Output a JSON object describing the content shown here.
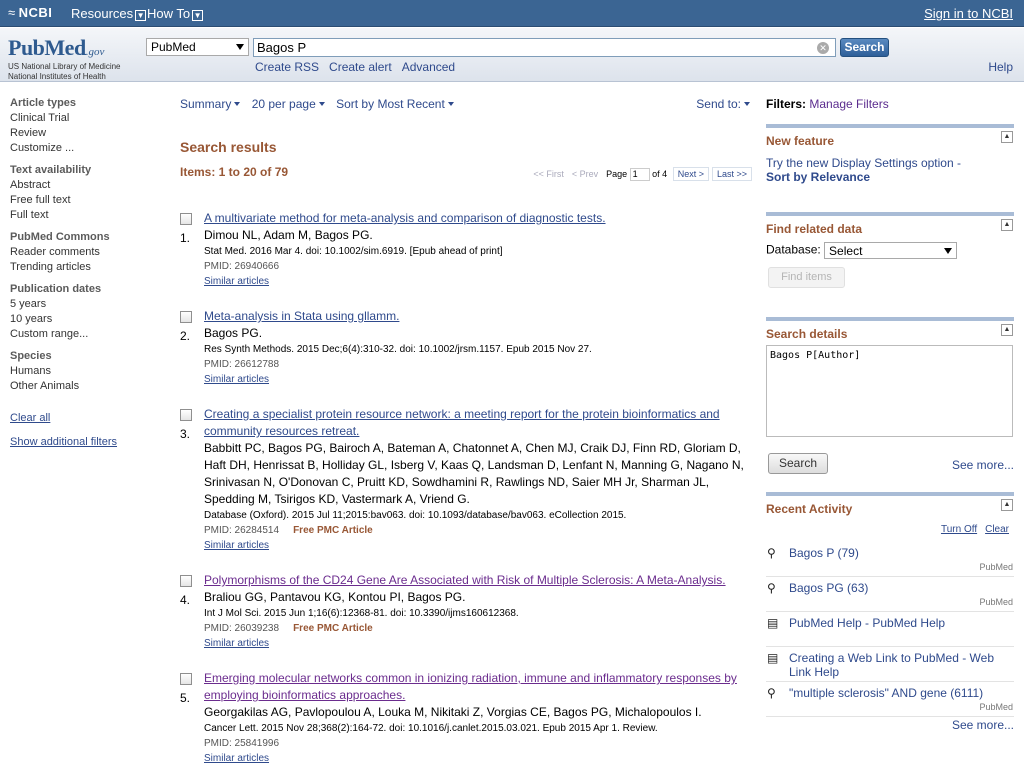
{
  "topbar": {
    "ncbi": "NCBI",
    "resources": "Resources",
    "howto": "How To",
    "signin": "Sign in to NCBI"
  },
  "brand": {
    "pubmed": "PubMed",
    "gov": ".gov",
    "line1": "US National Library of Medicine",
    "line2": "National Institutes of Health"
  },
  "search": {
    "database": "PubMed",
    "query": "Bagos P",
    "button": "Search",
    "links": [
      "Create RSS",
      "Create alert",
      "Advanced"
    ],
    "help": "Help"
  },
  "left_filters": {
    "groups": [
      {
        "header": "Article types",
        "items": [
          "Clinical Trial",
          "Review",
          "Customize ..."
        ]
      },
      {
        "header": "Text availability",
        "items": [
          "Abstract",
          "Free full text",
          "Full text"
        ]
      },
      {
        "header": "PubMed Commons",
        "items": [
          "Reader comments",
          "Trending articles"
        ]
      },
      {
        "header": "Publication dates",
        "items": [
          "5 years",
          "10 years",
          "Custom range..."
        ]
      },
      {
        "header": "Species",
        "items": [
          "Humans",
          "Other Animals"
        ]
      }
    ],
    "clear_all": "Clear all",
    "show_additional": "Show additional filters"
  },
  "toolbar": {
    "summary": "Summary",
    "per_page": "20 per page",
    "sort": "Sort by Most Recent",
    "send_to": "Send to:"
  },
  "results": {
    "title": "Search results",
    "items": "Items: 1 to 20 of 79",
    "pager": {
      "first": "<< First",
      "prev": "< Prev",
      "page_label": "Page",
      "page": "1",
      "of": "of 4",
      "next": "Next >",
      "last": "Last >>"
    },
    "list": [
      {
        "num": "1.",
        "title": "A multivariate method for meta-analysis and comparison of diagnostic tests.",
        "authors": "Dimou NL, Adam M, Bagos PG.",
        "source": "Stat Med. 2016 Mar 4. doi: 10.1002/sim.6919. [Epub ahead of print]",
        "pmid": "PMID: 26940666",
        "pmc": "",
        "similar": "Similar articles"
      },
      {
        "num": "2.",
        "title": "Meta-analysis in Stata using gllamm.",
        "authors": "Bagos PG.",
        "source": "Res Synth Methods. 2015 Dec;6(4):310-32. doi: 10.1002/jrsm.1157. Epub 2015 Nov 27.",
        "pmid": "PMID: 26612788",
        "pmc": "",
        "similar": "Similar articles"
      },
      {
        "num": "3.",
        "title": "Creating a specialist protein resource network: a meeting report for the protein bioinformatics and community resources retreat.",
        "authors": "Babbitt PC, Bagos PG, Bairoch A, Bateman A, Chatonnet A, Chen MJ, Craik DJ, Finn RD, Gloriam D, Haft DH, Henrissat B, Holliday GL, Isberg V, Kaas Q, Landsman D, Lenfant N, Manning G, Nagano N, Srinivasan N, O'Donovan C, Pruitt KD, Sowdhamini R, Rawlings ND, Saier MH Jr, Sharman JL, Spedding M, Tsirigos KD, Vastermark A, Vriend G.",
        "source": "Database (Oxford). 2015 Jul 11;2015:bav063. doi: 10.1093/database/bav063. eCollection 2015.",
        "pmid": "PMID: 26284514",
        "pmc": "Free PMC Article",
        "similar": "Similar articles"
      },
      {
        "num": "4.",
        "title": "Polymorphisms of the CD24 Gene Are Associated with Risk of Multiple Sclerosis: A Meta-Analysis.",
        "authors": "Braliou GG, Pantavou KG, Kontou PI, Bagos PG.",
        "source": "Int J Mol Sci. 2015 Jun 1;16(6):12368-81. doi: 10.3390/ijms160612368.",
        "pmid": "PMID: 26039238",
        "pmc": "Free PMC Article",
        "similar": "Similar articles"
      },
      {
        "num": "5.",
        "title": "Emerging molecular networks common in ionizing radiation, immune and inflammatory responses by employing bioinformatics approaches.",
        "authors": "Georgakilas AG, Pavlopoulou A, Louka M, Nikitaki Z, Vorgias CE, Bagos PG, Michalopoulos I.",
        "source": "Cancer Lett. 2015 Nov 28;368(2):164-72. doi: 10.1016/j.canlet.2015.03.021. Epub 2015 Apr 1. Review.",
        "pmid": "PMID: 25841996",
        "pmc": "",
        "similar": "Similar articles"
      }
    ]
  },
  "right": {
    "filters_label": "Filters:",
    "manage_filters": "Manage Filters",
    "new_feature": {
      "header": "New feature",
      "text": "Try the new Display Settings option -",
      "bold": "Sort by Relevance"
    },
    "find_related": {
      "header": "Find related data",
      "db_label": "Database:",
      "db_value": "Select",
      "button": "Find items"
    },
    "search_details": {
      "header": "Search details",
      "text": "Bagos P[Author]",
      "button": "Search",
      "see_more": "See more..."
    },
    "recent": {
      "header": "Recent Activity",
      "turn_off": "Turn Off",
      "clear": "Clear",
      "items": [
        {
          "icon": "search-icon",
          "text": "Bagos P (79)",
          "db": "PubMed"
        },
        {
          "icon": "search-icon",
          "text": "Bagos PG (63)",
          "db": "PubMed"
        },
        {
          "icon": "document-icon",
          "text": "PubMed Help - PubMed Help",
          "db": ""
        },
        {
          "icon": "document-icon",
          "text": "Creating a Web Link to PubMed - Web Link Help",
          "db": ""
        },
        {
          "icon": "search-icon",
          "text": "\"multiple sclerosis\" AND gene (6111)",
          "db": "PubMed"
        }
      ],
      "see_more": "See more..."
    }
  }
}
